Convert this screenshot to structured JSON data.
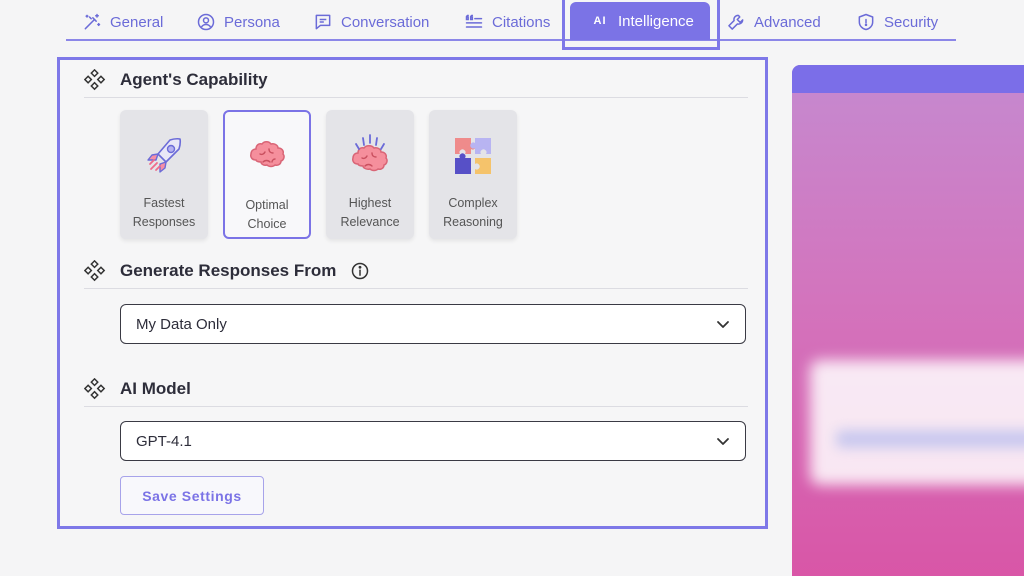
{
  "tabs": [
    {
      "id": "general",
      "label": "General",
      "icon": "wand-icon"
    },
    {
      "id": "persona",
      "label": "Persona",
      "icon": "user-circle-icon"
    },
    {
      "id": "conversation",
      "label": "Conversation",
      "icon": "chat-icon"
    },
    {
      "id": "citations",
      "label": "Citations",
      "icon": "quote-list-icon"
    },
    {
      "id": "intelligence",
      "label": "Intelligence",
      "icon": "ai-icon",
      "glyph": "AI",
      "active": true
    },
    {
      "id": "advanced",
      "label": "Advanced",
      "icon": "wrench-icon"
    },
    {
      "id": "security",
      "label": "Security",
      "icon": "shield-icon"
    }
  ],
  "capability": {
    "title": "Agent's Capability",
    "options": [
      {
        "label": "Fastest Responses",
        "icon": "rocket-icon",
        "selected": false
      },
      {
        "label": "Optimal Choice",
        "icon": "brain-icon",
        "selected": true
      },
      {
        "label": "Highest Relevance",
        "icon": "brain-sparks-icon",
        "selected": false
      },
      {
        "label": "Complex Reasoning",
        "icon": "puzzle-icon",
        "selected": false
      }
    ]
  },
  "responses": {
    "title": "Generate Responses From",
    "value": "My Data Only"
  },
  "model": {
    "title": "AI Model",
    "value": "GPT-4.1"
  },
  "save_label": "Save Settings",
  "colors": {
    "accent": "#7b73e6",
    "tab_text": "#6b6bd8",
    "preview_top": "#7b6ee8",
    "preview_gradient": "#d955a6"
  }
}
